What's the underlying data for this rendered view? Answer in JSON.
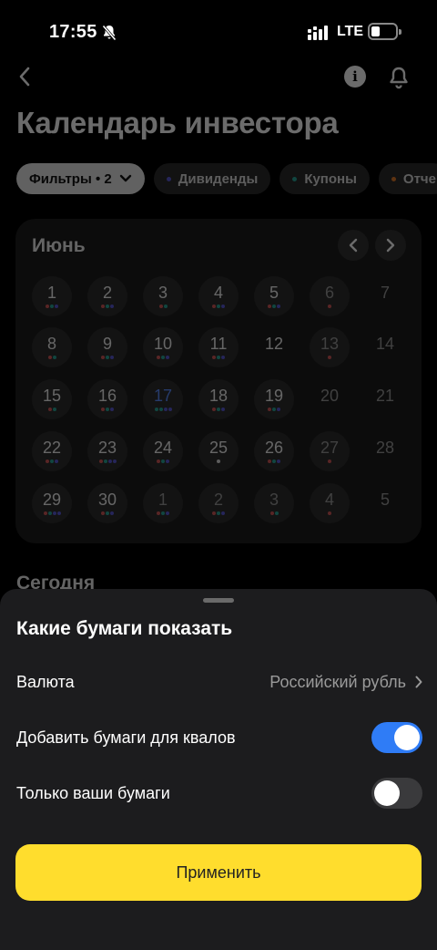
{
  "status_bar": {
    "time": "17:55",
    "network": "LTE"
  },
  "header": {
    "title": "Календарь инвестора"
  },
  "filters": [
    {
      "label": "Фильтры • 2",
      "active": true
    },
    {
      "label": "Дивиденды",
      "dot_color": "#5b5bd6"
    },
    {
      "label": "Купоны",
      "dot_color": "#2aa69a"
    },
    {
      "label": "Отче",
      "dot_color": "#e07a2a"
    }
  ],
  "calendar": {
    "month": "Июнь",
    "weeks": [
      [
        {
          "n": "1",
          "bg": true,
          "dots": [
            "#d35a5a",
            "#2aa69a",
            "#5b5bd6"
          ]
        },
        {
          "n": "2",
          "bg": true,
          "dots": [
            "#d35a5a",
            "#2aa69a",
            "#5b5bd6"
          ]
        },
        {
          "n": "3",
          "bg": true,
          "dots": [
            "#d35a5a",
            "#2aa69a"
          ]
        },
        {
          "n": "4",
          "bg": true,
          "dots": [
            "#d35a5a",
            "#2aa69a",
            "#5b5bd6"
          ]
        },
        {
          "n": "5",
          "bg": true,
          "dots": [
            "#d35a5a",
            "#2aa69a",
            "#5b5bd6"
          ]
        },
        {
          "n": "6",
          "bg": true,
          "muted": true,
          "dots": [
            "#d35a5a"
          ]
        },
        {
          "n": "7",
          "muted": true,
          "dots": []
        }
      ],
      [
        {
          "n": "8",
          "bg": true,
          "dots": [
            "#d35a5a",
            "#2aa69a"
          ]
        },
        {
          "n": "9",
          "bg": true,
          "dots": [
            "#d35a5a",
            "#2aa69a",
            "#5b5bd6"
          ]
        },
        {
          "n": "10",
          "bg": true,
          "dots": [
            "#d35a5a",
            "#2aa69a",
            "#5b5bd6"
          ]
        },
        {
          "n": "11",
          "bg": true,
          "dots": [
            "#d35a5a",
            "#2aa69a",
            "#5b5bd6"
          ]
        },
        {
          "n": "12",
          "dots": []
        },
        {
          "n": "13",
          "bg": true,
          "muted": true,
          "dots": [
            "#d35a5a"
          ]
        },
        {
          "n": "14",
          "muted": true,
          "dots": []
        }
      ],
      [
        {
          "n": "15",
          "bg": true,
          "dots": [
            "#d35a5a",
            "#2aa69a"
          ]
        },
        {
          "n": "16",
          "bg": true,
          "dots": [
            "#d35a5a",
            "#2aa69a",
            "#5b5bd6"
          ]
        },
        {
          "n": "17",
          "bg": true,
          "today": true,
          "dots": [
            "#2aa69a",
            "#2aa69a",
            "#5b5bd6",
            "#5b5bd6"
          ]
        },
        {
          "n": "18",
          "bg": true,
          "dots": [
            "#d35a5a",
            "#2aa69a",
            "#5b5bd6"
          ]
        },
        {
          "n": "19",
          "bg": true,
          "dots": [
            "#d35a5a",
            "#2aa69a",
            "#5b5bd6"
          ]
        },
        {
          "n": "20",
          "muted": true,
          "dots": []
        },
        {
          "n": "21",
          "muted": true,
          "dots": []
        }
      ],
      [
        {
          "n": "22",
          "bg": true,
          "dots": [
            "#d35a5a",
            "#2aa69a",
            "#5b5bd6"
          ]
        },
        {
          "n": "23",
          "bg": true,
          "dots": [
            "#d35a5a",
            "#2aa69a",
            "#5b5bd6",
            "#5b5bd6"
          ]
        },
        {
          "n": "24",
          "bg": true,
          "dots": [
            "#d35a5a",
            "#2aa69a",
            "#5b5bd6"
          ]
        },
        {
          "n": "25",
          "bg": true,
          "dots": [
            "#dddddd"
          ]
        },
        {
          "n": "26",
          "bg": true,
          "dots": [
            "#d35a5a",
            "#2aa69a",
            "#5b5bd6"
          ]
        },
        {
          "n": "27",
          "bg": true,
          "muted": true,
          "dots": [
            "#d35a5a"
          ]
        },
        {
          "n": "28",
          "muted": true,
          "dots": []
        }
      ],
      [
        {
          "n": "29",
          "bg": true,
          "dots": [
            "#d35a5a",
            "#2aa69a",
            "#5b5bd6",
            "#5b5bd6"
          ]
        },
        {
          "n": "30",
          "bg": true,
          "dots": [
            "#d35a5a",
            "#2aa69a",
            "#5b5bd6"
          ]
        },
        {
          "n": "1",
          "bg": true,
          "muted": true,
          "dots": [
            "#d35a5a",
            "#2aa69a",
            "#5b5bd6"
          ]
        },
        {
          "n": "2",
          "bg": true,
          "muted": true,
          "dots": [
            "#d35a5a",
            "#2aa69a",
            "#5b5bd6"
          ]
        },
        {
          "n": "3",
          "bg": true,
          "muted": true,
          "dots": [
            "#d35a5a",
            "#2aa69a"
          ]
        },
        {
          "n": "4",
          "bg": true,
          "muted": true,
          "dots": [
            "#d35a5a"
          ]
        },
        {
          "n": "5",
          "muted": true,
          "dots": []
        }
      ]
    ]
  },
  "section": {
    "today_label": "Сегодня"
  },
  "sheet": {
    "title": "Какие бумаги показать",
    "currency_label": "Валюта",
    "currency_value": "Российский рубль",
    "qual_label": "Добавить бумаги для квалов",
    "qual_on": true,
    "own_label": "Только ваши бумаги",
    "own_on": false,
    "apply_label": "Применить"
  },
  "colors": {
    "accent_yellow": "#ffdd2d",
    "toggle_blue": "#2f7cf6"
  }
}
